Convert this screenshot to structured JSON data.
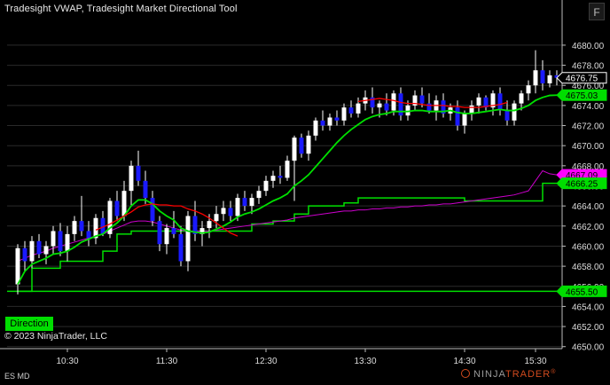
{
  "title": "Tradesight VWAP, Tradesight Market Directional Tool",
  "f_button": "F",
  "direction_button": "Direction",
  "copyright": "© 2023 NinjaTrader, LLC",
  "instrument": "ES MD",
  "logo": {
    "ninja": "NINJA",
    "trader": "TRADER",
    "registered": "®"
  },
  "colors": {
    "background": "#000000",
    "up_candle": "#ffffff",
    "down_candle": "#1a1aff",
    "grid": "#2a2a2a",
    "green_line": "#00e000",
    "vwap_red": "#ff0000",
    "magenta_line": "#cc00cc",
    "marker_white": "#ffffff",
    "marker_green": "#00dd00",
    "marker_magenta": "#ff00ff"
  },
  "chart_data": {
    "type": "candlestick",
    "x_ticks": [
      "10:30",
      "11:30",
      "12:30",
      "13:30",
      "14:30",
      "15:30"
    ],
    "y_ticks": [
      "4680.00",
      "4678.00",
      "4676.00",
      "4674.00",
      "4672.00",
      "4670.00",
      "4668.00",
      "4666.00",
      "4664.00",
      "4662.00",
      "4660.00",
      "4658.00",
      "4656.00",
      "4654.00",
      "4652.00",
      "4650.00"
    ],
    "ylim": [
      4649.8,
      4682.2
    ],
    "price_markers": [
      {
        "label": "4676.75",
        "value": 4676.75,
        "style": "white"
      },
      {
        "label": "4675.03",
        "value": 4675.03,
        "style": "green"
      },
      {
        "label": "4667.09",
        "value": 4667.09,
        "style": "magenta"
      },
      {
        "label": "4666.25",
        "value": 4666.25,
        "style": "green"
      },
      {
        "label": "4655.50",
        "value": 4655.5,
        "style": "green"
      }
    ],
    "candles": [
      [
        4656.2,
        4660.2,
        4655.2,
        4659.8
      ],
      [
        4659.8,
        4660.5,
        4657.5,
        4658.5
      ],
      [
        4658.5,
        4661,
        4657.8,
        4660.5
      ],
      [
        4660.5,
        4661.2,
        4658.8,
        4659.2
      ],
      [
        4659.2,
        4660.5,
        4658.2,
        4660
      ],
      [
        4660,
        4662,
        4659.2,
        4661.5
      ],
      [
        4661.5,
        4662.3,
        4659,
        4659.5
      ],
      [
        4659.5,
        4662,
        4658.5,
        4661.2
      ],
      [
        4661.2,
        4663,
        4660.5,
        4662.5
      ],
      [
        4662.5,
        4665,
        4661,
        4661.5
      ],
      [
        4661.5,
        4662.5,
        4660,
        4660.8
      ],
      [
        4660.8,
        4663.2,
        4660.2,
        4662.8
      ],
      [
        4662.8,
        4663.5,
        4661,
        4661.2
      ],
      [
        4661.2,
        4664.8,
        4660.8,
        4664.5
      ],
      [
        4664.5,
        4665.5,
        4662.5,
        4663
      ],
      [
        4663,
        4666.5,
        4662.5,
        4665.5
      ],
      [
        4665.5,
        4668.5,
        4664,
        4668
      ],
      [
        4668,
        4669.5,
        4666,
        4666.5
      ],
      [
        4666.5,
        4667.5,
        4664.2,
        4664.8
      ],
      [
        4664.8,
        4665.5,
        4662,
        4662.5
      ],
      [
        4662.5,
        4663,
        4659.5,
        4660.2
      ],
      [
        4660.2,
        4662.2,
        4659.2,
        4661.8
      ],
      [
        4661.8,
        4663.5,
        4660.8,
        4661.2
      ],
      [
        4661.2,
        4662,
        4658,
        4658.5
      ],
      [
        4658.5,
        4663.5,
        4657.5,
        4663
      ],
      [
        4663,
        4664.5,
        4660.5,
        4661.2
      ],
      [
        4661.2,
        4662.5,
        4660,
        4661.8
      ],
      [
        4661.8,
        4663.2,
        4660.8,
        4662.5
      ],
      [
        4662.5,
        4664,
        4661.8,
        4663.2
      ],
      [
        4663.2,
        4664.5,
        4662.5,
        4663.8
      ],
      [
        4663.8,
        4664.5,
        4662.5,
        4663
      ],
      [
        4663,
        4665.2,
        4662.5,
        4664.8
      ],
      [
        4664.8,
        4665.5,
        4663.5,
        4664
      ],
      [
        4664,
        4665.2,
        4663.2,
        4664.8
      ],
      [
        4664.8,
        4666,
        4664.2,
        4665.5
      ],
      [
        4665.5,
        4667,
        4665,
        4666.5
      ],
      [
        4666.5,
        4667.5,
        4665.8,
        4667
      ],
      [
        4667,
        4668,
        4666.2,
        4666.8
      ],
      [
        4666.8,
        4669,
        4666.5,
        4668.5
      ],
      [
        4668.5,
        4671,
        4664.5,
        4670.8
      ],
      [
        4670.8,
        4671.2,
        4668.8,
        4669.2
      ],
      [
        4669.2,
        4671.5,
        4668.5,
        4671
      ],
      [
        4671,
        4672.8,
        4670.5,
        4672.5
      ],
      [
        4672.5,
        4673.5,
        4671.5,
        4672
      ],
      [
        4672,
        4673.2,
        4671.5,
        4672.8
      ],
      [
        4672.8,
        4673.5,
        4672,
        4672.5
      ],
      [
        4672.5,
        4674.2,
        4672,
        4673.8
      ],
      [
        4673.8,
        4674.5,
        4672.8,
        4673.2
      ],
      [
        4673.2,
        4674.8,
        4672.8,
        4674.2
      ],
      [
        4674.2,
        4675.5,
        4673.5,
        4674.8
      ],
      [
        4674.8,
        4675.8,
        4673.2,
        4673.8
      ],
      [
        4673.8,
        4674.5,
        4672.8,
        4674.2
      ],
      [
        4674.2,
        4675.2,
        4673,
        4673.5
      ],
      [
        4673.5,
        4675.5,
        4673,
        4675.2
      ],
      [
        4675.2,
        4675.8,
        4672.5,
        4673
      ],
      [
        4673,
        4674.5,
        4672.5,
        4674
      ],
      [
        4674,
        4675.5,
        4673.5,
        4675
      ],
      [
        4675,
        4675.8,
        4673.8,
        4674.2
      ],
      [
        4674.2,
        4675.2,
        4673.2,
        4673.5
      ],
      [
        4673.5,
        4675,
        4672.5,
        4674.5
      ],
      [
        4674.5,
        4675.2,
        4672.8,
        4673.2
      ],
      [
        4673.2,
        4674.2,
        4672.5,
        4673.8
      ],
      [
        4673.8,
        4674.5,
        4671.5,
        4672
      ],
      [
        4672,
        4673.5,
        4671.2,
        4673.2
      ],
      [
        4673.2,
        4674.5,
        4672.5,
        4674
      ],
      [
        4674,
        4675.2,
        4673.2,
        4674.8
      ],
      [
        4674.8,
        4675,
        4673.5,
        4673.8
      ],
      [
        4673.8,
        4675.5,
        4673,
        4675.2
      ],
      [
        4675.2,
        4675.8,
        4673,
        4673.5
      ],
      [
        4673.5,
        4674.5,
        4672,
        4672.5
      ],
      [
        4672.5,
        4674.5,
        4672,
        4674.2
      ],
      [
        4674.2,
        4675.5,
        4673.5,
        4675.2
      ],
      [
        4675.2,
        4676.5,
        4674.5,
        4676
      ],
      [
        4676,
        4679.5,
        4675.2,
        4677.5
      ],
      [
        4677.5,
        4678.5,
        4675.5,
        4676.2
      ],
      [
        4676.2,
        4677.5,
        4675.8,
        4677
      ],
      [
        4677,
        4677.5,
        4676,
        4676.75
      ]
    ],
    "red_vwap_segments": [
      {
        "start": 11,
        "values": [
          4661.6,
          4661.9,
          4662.2,
          4662.6,
          4663,
          4663.4,
          4663.9,
          4664.1,
          4664.2,
          4664.1,
          4664.1,
          4664,
          4664,
          4663.7,
          4663.5,
          4663.2,
          4662.8,
          4662.3,
          4661.8,
          4661.3,
          4661.0
        ]
      },
      {
        "start": 48,
        "values": [
          4674.4,
          4674.5,
          4674.6,
          4674.7,
          4674.6,
          4674.5,
          4674.3,
          4674.2,
          4674.2,
          4674.1,
          4674.0,
          4674.0,
          4674.0,
          4673.9,
          4673.9,
          4673.8,
          4673.8,
          4673.8,
          4673.9,
          4674.0,
          4674.1,
          4674.3
        ]
      }
    ],
    "green_fast": [
      4656.2,
      4657.5,
      4658.2,
      4658.5,
      4658.8,
      4659.2,
      4659.3,
      4659.5,
      4659.9,
      4660.4,
      4660.7,
      4661,
      4661.2,
      4661.8,
      4662.3,
      4663,
      4664,
      4664.6,
      4664.6,
      4664.2,
      4663.5,
      4663,
      4662.6,
      4661.8,
      4661.5,
      4661.4,
      4661.3,
      4661.4,
      4661.7,
      4662,
      4662.4,
      4662.9,
      4663.2,
      4663.4,
      4663.7,
      4664.1,
      4664.5,
      4664.8,
      4665.2,
      4666,
      4666.5,
      4667.1,
      4667.9,
      4668.7,
      4669.5,
      4670.3,
      4671,
      4671.6,
      4672.1,
      4672.6,
      4672.9,
      4673.1,
      4673.2,
      4673.4,
      4673.4,
      4673.4,
      4673.5,
      4673.5,
      4673.4,
      4673.4,
      4673.4,
      4673.5,
      4673.3,
      4673.2,
      4673.2,
      4673.3,
      4673.4,
      4673.5,
      4673.6,
      4673.5,
      4673.5,
      4673.7,
      4674,
      4674.5,
      4674.8,
      4675,
      4675.03
    ],
    "magenta_line": [
      4658.5,
      4658.8,
      4659.1,
      4659.3,
      4659.5,
      4659.8,
      4660,
      4660.2,
      4660.4,
      4660.6,
      4660.8,
      4661,
      4661.2,
      4661.5,
      4661.8,
      4662.1,
      4662.4,
      4662.5,
      4662.5,
      4662.4,
      4662.2,
      4662,
      4661.8,
      4661.6,
      4661.5,
      4661.5,
      4661.5,
      4661.5,
      4661.6,
      4661.7,
      4661.8,
      4661.9,
      4662,
      4662.1,
      4662.2,
      4662.3,
      4662.4,
      4662.5,
      4662.6,
      4662.8,
      4662.9,
      4663,
      4663.1,
      4663.2,
      4663.3,
      4663.4,
      4663.5,
      4663.5,
      4663.6,
      4663.6,
      4663.7,
      4663.7,
      4663.8,
      4663.8,
      4663.9,
      4663.9,
      4664,
      4664,
      4664.1,
      4664.1,
      4664.2,
      4664.2,
      4664.3,
      4664.4,
      4664.5,
      4664.6,
      4664.7,
      4664.8,
      4664.9,
      4665,
      4665.1,
      4665.3,
      4665.5,
      4666.5,
      4667.5,
      4667.2,
      4667.09
    ],
    "green_step": [
      [
        0,
        4655.5
      ],
      [
        2,
        4657.8
      ],
      [
        6,
        4658.5
      ],
      [
        10,
        4658.5
      ],
      [
        12,
        4659.5
      ],
      [
        14,
        4661.2
      ],
      [
        16,
        4661.5
      ],
      [
        30,
        4661.5
      ],
      [
        33,
        4662.2
      ],
      [
        36,
        4662.5
      ],
      [
        39,
        4663.2
      ],
      [
        41,
        4664.0
      ],
      [
        46,
        4664.3
      ],
      [
        48,
        4664.8
      ],
      [
        58,
        4664.8
      ],
      [
        63,
        4664.5
      ],
      [
        73,
        4664.5
      ],
      [
        74,
        4666.25
      ],
      [
        76,
        4666.25
      ]
    ],
    "support_level": 4655.5
  }
}
